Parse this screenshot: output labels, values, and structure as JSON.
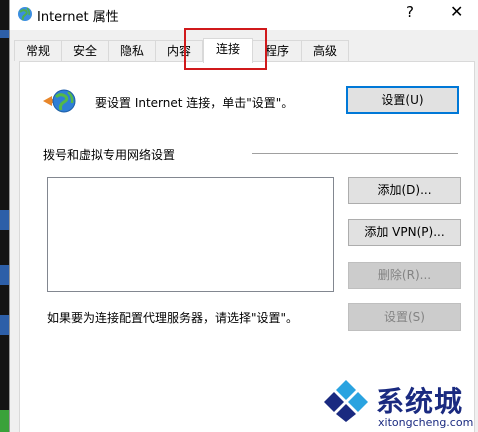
{
  "window": {
    "title": "Internet 属性",
    "help_glyph": "?",
    "close_glyph": "✕"
  },
  "tabs": [
    {
      "label": "常规"
    },
    {
      "label": "安全"
    },
    {
      "label": "隐私"
    },
    {
      "label": "内容"
    },
    {
      "label": "连接"
    },
    {
      "label": "程序"
    },
    {
      "label": "高级"
    }
  ],
  "active_tab": "连接",
  "connection": {
    "setup_text": "要设置 Internet 连接，单击\"设置\"。",
    "setup_button": "设置(U)",
    "dialup_group_label": "拨号和虚拟专用网络设置",
    "add_button": "添加(D)...",
    "add_vpn_button": "添加 VPN(P)...",
    "delete_button": "删除(R)...",
    "settings_button": "设置(S)",
    "proxy_text": "如果要为连接配置代理服务器，请选择\"设置\"。"
  },
  "watermark": {
    "brand": "系统城",
    "site": "xitongcheng.com"
  },
  "colors": {
    "highlight_box": "#d0191b",
    "primary_border": "#0078d7",
    "watermark": "#1a2a80"
  }
}
